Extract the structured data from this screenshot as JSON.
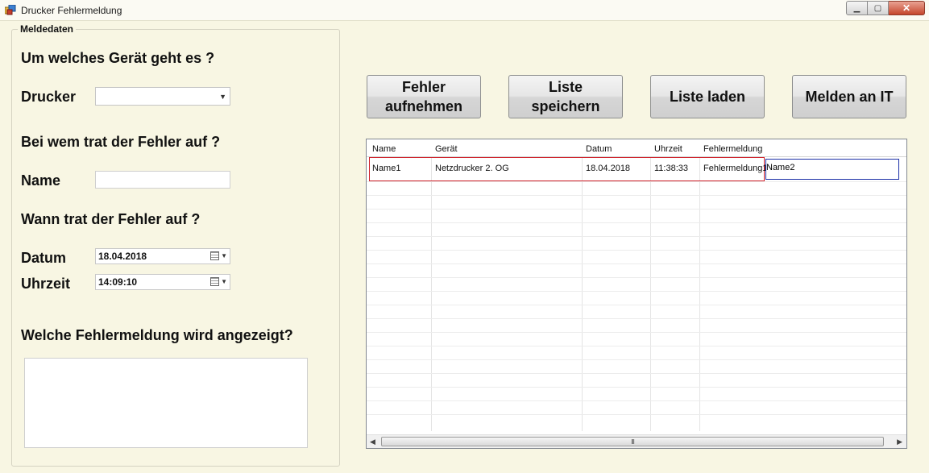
{
  "window": {
    "title": "Drucker Fehlermeldung",
    "min_glyph": "▁",
    "max_glyph": "▢",
    "close_glyph": "✕",
    "icon": "app-icon"
  },
  "group": {
    "title": "Meldedaten",
    "q_device": "Um welches Gerät geht es ?",
    "label_drucker": "Drucker",
    "drucker_value": "",
    "q_who": "Bei wem trat der Fehler auf ?",
    "label_name": "Name",
    "name_value": "",
    "q_when": "Wann trat der Fehler auf ?",
    "label_datum": "Datum",
    "datum_value": "18.04.2018",
    "label_uhrzeit": "Uhrzeit",
    "uhrzeit_value": "14:09:10",
    "q_message": "Welche Fehlermeldung wird angezeigt?",
    "message_value": ""
  },
  "buttons": {
    "fehler_aufnehmen": "Fehler\naufnehmen",
    "liste_speichern": "Liste\nspeichern",
    "liste_laden": "Liste laden",
    "melden_an_it": "Melden an IT"
  },
  "grid": {
    "columns": [
      "Name",
      "Gerät",
      "Datum",
      "Uhrzeit",
      "Fehlermeldung"
    ],
    "rows": [
      {
        "name": "Name1",
        "geraet": "Netzdrucker 2. OG",
        "datum": "18.04.2018",
        "uhrzeit": "11:38:33",
        "fehlermeldung": "Fehlermeldung1"
      }
    ],
    "editing_cell_value": "Name2",
    "scroll_grip": "III"
  },
  "colors": {
    "background": "#f8f6e3",
    "selection_border": "#d0212a",
    "edit_border": "#1b2fa7"
  }
}
